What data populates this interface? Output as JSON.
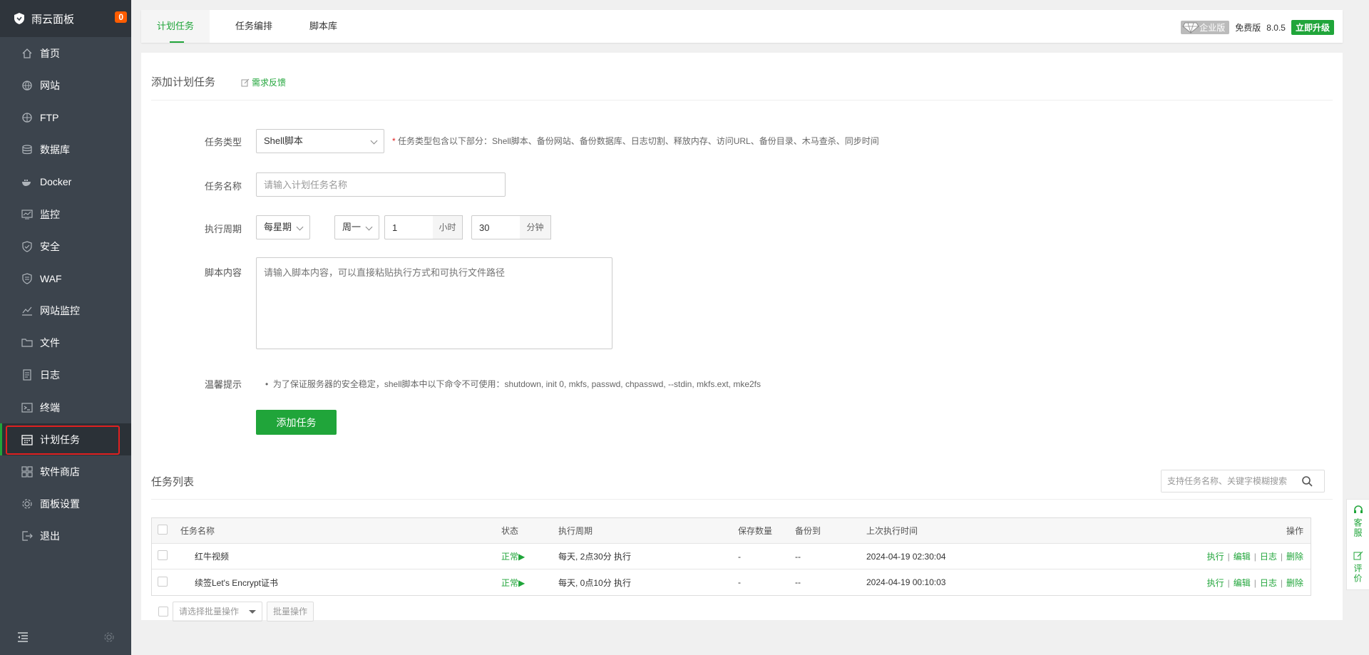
{
  "sidebar": {
    "title": "雨云面板",
    "badge": "0",
    "items": [
      {
        "label": "首页",
        "icon": "home-icon"
      },
      {
        "label": "网站",
        "icon": "globe-icon"
      },
      {
        "label": "FTP",
        "icon": "ftp-icon"
      },
      {
        "label": "数据库",
        "icon": "database-icon"
      },
      {
        "label": "Docker",
        "icon": "docker-icon"
      },
      {
        "label": "监控",
        "icon": "monitor-icon"
      },
      {
        "label": "安全",
        "icon": "shield-icon"
      },
      {
        "label": "WAF",
        "icon": "waf-shield-icon"
      },
      {
        "label": "网站监控",
        "icon": "chart-icon"
      },
      {
        "label": "文件",
        "icon": "folder-icon"
      },
      {
        "label": "日志",
        "icon": "log-icon"
      },
      {
        "label": "终端",
        "icon": "terminal-icon"
      },
      {
        "label": "计划任务",
        "icon": "calendar-icon"
      },
      {
        "label": "软件商店",
        "icon": "grid-icon"
      },
      {
        "label": "面板设置",
        "icon": "gear-icon"
      },
      {
        "label": "退出",
        "icon": "logout-icon"
      }
    ],
    "active_index": 12
  },
  "topbar": {
    "tabs": [
      "计划任务",
      "任务编排",
      "脚本库"
    ],
    "enterprise": "企业版",
    "edition": "免费版",
    "version": "8.0.5",
    "upgrade": "立即升级"
  },
  "form": {
    "title": "添加计划任务",
    "feedback": "需求反馈",
    "type_label": "任务类型",
    "type_value": "Shell脚本",
    "type_hint_star": "*",
    "type_hint": "任务类型包含以下部分：Shell脚本、备份网站、备份数据库、日志切割、释放内存、访问URL、备份目录、木马查杀、同步时间",
    "name_label": "任务名称",
    "name_placeholder": "请输入计划任务名称",
    "cycle_label": "执行周期",
    "cycle_type": "每星期",
    "cycle_day": "周一",
    "hour_value": "1",
    "hour_unit": "小时",
    "minute_value": "30",
    "minute_unit": "分钟",
    "script_label": "脚本内容",
    "script_placeholder": "请输入脚本内容，可以直接粘贴执行方式和可执行文件路径",
    "tip_label": "温馨提示",
    "tip_text": "为了保证服务器的安全稳定，shell脚本中以下命令不可使用：shutdown, init 0, mkfs, passwd, chpasswd, --stdin, mkfs.ext, mke2fs",
    "submit": "添加任务"
  },
  "list": {
    "title": "任务列表",
    "search_placeholder": "支持任务名称、关键字模糊搜索",
    "columns": [
      "任务名称",
      "状态",
      "执行周期",
      "保存数量",
      "备份到",
      "上次执行时间",
      "操作"
    ],
    "rows": [
      {
        "name": "红牛视频",
        "status": "正常▶",
        "cycle": "每天, 2点30分 执行",
        "keep": "-",
        "backup": "--",
        "last": "2024-04-19 02:30:04"
      },
      {
        "name": "续签Let's Encrypt证书",
        "status": "正常▶",
        "cycle": "每天, 0点10分 执行",
        "keep": "-",
        "backup": "--",
        "last": "2024-04-19 00:10:03"
      }
    ],
    "ops": [
      "执行",
      "编辑",
      "日志",
      "删除"
    ],
    "batch_placeholder": "请选择批量操作",
    "batch_button": "批量操作"
  },
  "float": {
    "service": "客服",
    "review": "评价"
  },
  "colors": {
    "accent": "#20a53a",
    "sidebar": "#3c444d",
    "highlight": "#e02020"
  }
}
